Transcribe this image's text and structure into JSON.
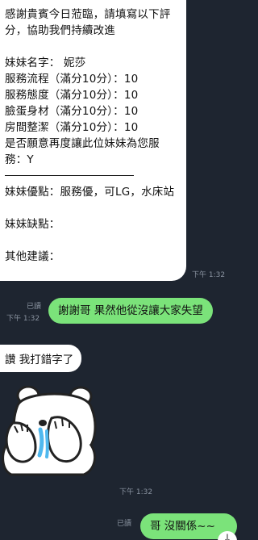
{
  "messages": {
    "form": {
      "lines": [
        "感謝貴賓今日蒞臨，請填寫以下評分，協助我們持續改進",
        "",
        "妹妹名字： 妮莎",
        "服務流程（滿分10分）：10",
        "服務態度（滿分10分）：10",
        "臉蛋身材（滿分10分）：10",
        "房間整潔（滿分10分）：10",
        "是否願意再度讓此位妹妹為您服務：Y"
      ],
      "lines_after_rule": [
        "妹妹優點：服務優，可LG，水床站",
        "",
        "妹妹缺點：",
        "",
        "其他建議："
      ],
      "time": "下午 1:32"
    },
    "reply1": {
      "read": "已讀",
      "time": "下午 1:32",
      "text": "謝謝哥 果然他從沒讓大家失望"
    },
    "incoming2": {
      "text": "讚 我打錯字了"
    },
    "sticker": {
      "icon": "polar-bear-covering-face-sticker",
      "time": "下午 1:32"
    },
    "reply2": {
      "read": "已讀",
      "text": "哥 沒關係~~"
    }
  },
  "scroll_button": {
    "icon": "arrow-down-icon",
    "glyph": "↓"
  },
  "colors": {
    "background": "#1e2530",
    "incoming_bubble": "#ffffff",
    "outgoing_bubble": "#7be37a",
    "meta_text": "#8a93a0"
  }
}
